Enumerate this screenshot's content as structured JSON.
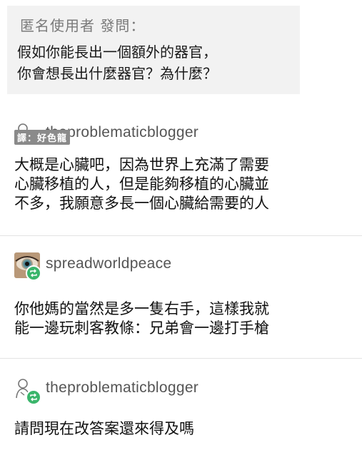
{
  "ask": {
    "asker_label": "匿名使用者 發問：",
    "question": "假如你能長出一個額外的器官，\n你會想長出什麼器官？為什麼？"
  },
  "translator_tag": "譯：好色龍",
  "posts": [
    {
      "username": "theproblematicblogger",
      "avatar_icon": "person-outline-icon",
      "text": "大概是心臟吧，因為世界上充滿了需要\n心臟移植的人，但是能夠移植的心臟並\n不多，我願意多長一個心臟給需要的人"
    },
    {
      "username": "spreadworldpeace",
      "avatar_icon": "eye-photo-avatar",
      "text": "你他媽的當然是多一隻右手，這樣我就\n能一邊玩刺客教條：兄弟會一邊打手槍"
    },
    {
      "username": "theproblematicblogger",
      "avatar_icon": "person-outline-icon",
      "text": "請問現在改答案還來得及嗎"
    }
  ],
  "colors": {
    "reblog_badge": "#3ab56b",
    "ask_bg": "#f2f2f2"
  }
}
